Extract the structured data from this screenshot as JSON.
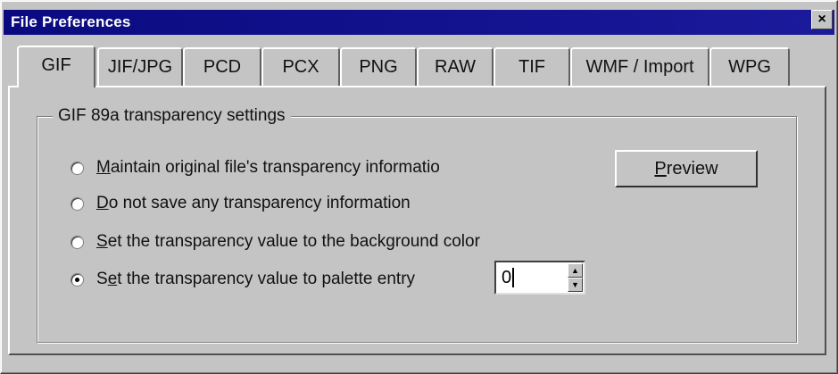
{
  "window": {
    "title": "File Preferences",
    "close_glyph": "×"
  },
  "tabs": [
    {
      "label": "GIF",
      "active": true
    },
    {
      "label": "JIF/JPG",
      "active": false
    },
    {
      "label": "PCD",
      "active": false
    },
    {
      "label": "PCX",
      "active": false
    },
    {
      "label": "PNG",
      "active": false
    },
    {
      "label": "RAW",
      "active": false
    },
    {
      "label": "TIF",
      "active": false
    },
    {
      "label": "WMF / Import",
      "active": false
    },
    {
      "label": "WPG",
      "active": false
    }
  ],
  "group": {
    "label": "GIF 89a transparency settings"
  },
  "options": [
    {
      "mnemonic": "M",
      "rest": "aintain original file's transparency informatio",
      "selected": false
    },
    {
      "mnemonic": "D",
      "rest": "o not save any transparency information",
      "selected": false
    },
    {
      "mnemonic": "S",
      "rest": "et the transparency value to the background color",
      "selected": false
    },
    {
      "prefix": "S",
      "mnemonic": "e",
      "rest": "t the transparency value to palette entry",
      "selected": true
    }
  ],
  "palette_entry": {
    "value": "0",
    "up_glyph": "▲",
    "down_glyph": "▼"
  },
  "preview_button": {
    "mnemonic": "P",
    "rest": "review"
  }
}
